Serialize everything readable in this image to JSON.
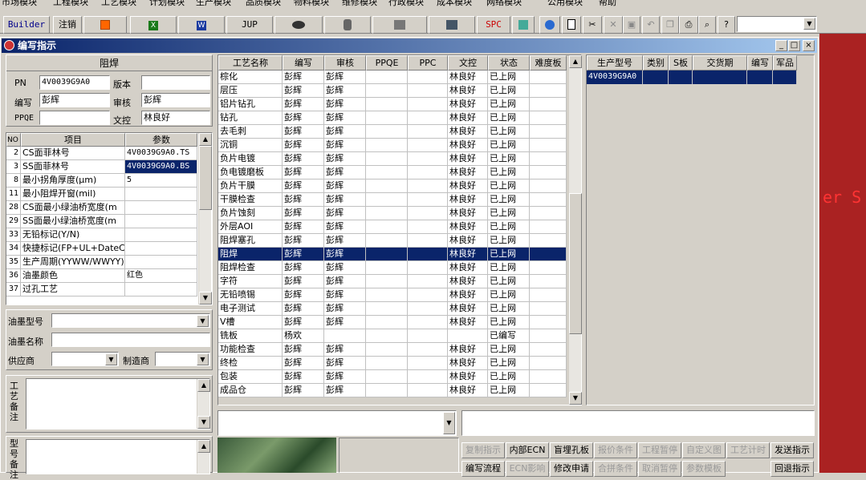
{
  "menubar": {
    "items": [
      "市场模块",
      "工程模块",
      "工艺模块",
      "计划模块",
      "生产模块",
      "品质模块",
      "物料模块",
      "维修模块",
      "行政模块",
      "成本模块",
      "网络模块",
      "公用模块",
      "帮助"
    ]
  },
  "toolbar": {
    "builder_label": "Builder",
    "logout_label": "注销",
    "jup_label": "JUP",
    "spc_label": "SPC"
  },
  "window": {
    "title": "编写指示",
    "minimize": "_",
    "restore": "□",
    "close": "×"
  },
  "form": {
    "section_title": "阻焊",
    "pn_label": "PN",
    "pn_value": "4V0039G9A0",
    "version_label": "版本",
    "version_value": "",
    "writer_label": "编写",
    "writer_value": "彭辉",
    "reviewer_label": "审核",
    "reviewer_value": "彭辉",
    "ppqe_label": "PPQE",
    "ppqe_value": "",
    "doccontrol_label": "文控",
    "doccontrol_value": "林良好"
  },
  "params": {
    "headers": [
      "NO",
      "项目",
      "参数"
    ],
    "rows": [
      {
        "no": "2",
        "item": "CS面菲林号",
        "value": "4V0039G9A0.TS"
      },
      {
        "no": "3",
        "item": "SS面菲林号",
        "value": "4V0039G9A0.BS"
      },
      {
        "no": "8",
        "item": "最小拐角厚度(μm)",
        "value": "5"
      },
      {
        "no": "11",
        "item": "最小阻焊开窗(mil)",
        "value": ""
      },
      {
        "no": "28",
        "item": "CS面最小绿油桥宽度(m",
        "value": ""
      },
      {
        "no": "29",
        "item": "SS面最小绿油桥宽度(m",
        "value": ""
      },
      {
        "no": "33",
        "item": "无铅标记(Y/N)",
        "value": ""
      },
      {
        "no": "34",
        "item": "快捷标记(FP+UL+DateCo",
        "value": ""
      },
      {
        "no": "35",
        "item": "生产周期(YYWW/WWYY)",
        "value": ""
      },
      {
        "no": "36",
        "item": "油墨颜色",
        "value": "红色"
      },
      {
        "no": "37",
        "item": "过孔工艺",
        "value": ""
      }
    ]
  },
  "ink": {
    "type_label": "油墨型号",
    "name_label": "油墨名称",
    "supplier_label": "供应商",
    "maker_label": "制造商",
    "process_note_label": "工艺备注",
    "model_note_label": "型号备注"
  },
  "process": {
    "headers": [
      "工艺名称",
      "编写",
      "审核",
      "PPQE",
      "PPC",
      "文控",
      "状态",
      "难度板"
    ],
    "rows": [
      {
        "name": "棕化",
        "writer": "彭辉",
        "reviewer": "彭辉",
        "ppqe": "",
        "ppc": "",
        "dc": "林良好",
        "status": "已上网"
      },
      {
        "name": "层压",
        "writer": "彭辉",
        "reviewer": "彭辉",
        "ppqe": "",
        "ppc": "",
        "dc": "林良好",
        "status": "已上网"
      },
      {
        "name": "铝片钻孔",
        "writer": "彭辉",
        "reviewer": "彭辉",
        "ppqe": "",
        "ppc": "",
        "dc": "林良好",
        "status": "已上网"
      },
      {
        "name": "钻孔",
        "writer": "彭辉",
        "reviewer": "彭辉",
        "ppqe": "",
        "ppc": "",
        "dc": "林良好",
        "status": "已上网"
      },
      {
        "name": "去毛刺",
        "writer": "彭辉",
        "reviewer": "彭辉",
        "ppqe": "",
        "ppc": "",
        "dc": "林良好",
        "status": "已上网"
      },
      {
        "name": "沉铜",
        "writer": "彭辉",
        "reviewer": "彭辉",
        "ppqe": "",
        "ppc": "",
        "dc": "林良好",
        "status": "已上网"
      },
      {
        "name": "负片电镀",
        "writer": "彭辉",
        "reviewer": "彭辉",
        "ppqe": "",
        "ppc": "",
        "dc": "林良好",
        "status": "已上网"
      },
      {
        "name": "负电镀磨板",
        "writer": "彭辉",
        "reviewer": "彭辉",
        "ppqe": "",
        "ppc": "",
        "dc": "林良好",
        "status": "已上网"
      },
      {
        "name": "负片干膜",
        "writer": "彭辉",
        "reviewer": "彭辉",
        "ppqe": "",
        "ppc": "",
        "dc": "林良好",
        "status": "已上网"
      },
      {
        "name": "干膜检查",
        "writer": "彭辉",
        "reviewer": "彭辉",
        "ppqe": "",
        "ppc": "",
        "dc": "林良好",
        "status": "已上网"
      },
      {
        "name": "负片蚀刻",
        "writer": "彭辉",
        "reviewer": "彭辉",
        "ppqe": "",
        "ppc": "",
        "dc": "林良好",
        "status": "已上网"
      },
      {
        "name": "外层AOI",
        "writer": "彭辉",
        "reviewer": "彭辉",
        "ppqe": "",
        "ppc": "",
        "dc": "林良好",
        "status": "已上网"
      },
      {
        "name": "阻焊塞孔",
        "writer": "彭辉",
        "reviewer": "彭辉",
        "ppqe": "",
        "ppc": "",
        "dc": "林良好",
        "status": "已上网"
      },
      {
        "name": "阻焊",
        "writer": "彭辉",
        "reviewer": "彭辉",
        "ppqe": "",
        "ppc": "",
        "dc": "林良好",
        "status": "已上网"
      },
      {
        "name": "阻焊检查",
        "writer": "彭辉",
        "reviewer": "彭辉",
        "ppqe": "",
        "ppc": "",
        "dc": "林良好",
        "status": "已上网"
      },
      {
        "name": "字符",
        "writer": "彭辉",
        "reviewer": "彭辉",
        "ppqe": "",
        "ppc": "",
        "dc": "林良好",
        "status": "已上网"
      },
      {
        "name": "无铅喷锡",
        "writer": "彭辉",
        "reviewer": "彭辉",
        "ppqe": "",
        "ppc": "",
        "dc": "林良好",
        "status": "已上网"
      },
      {
        "name": "电子测试",
        "writer": "彭辉",
        "reviewer": "彭辉",
        "ppqe": "",
        "ppc": "",
        "dc": "林良好",
        "status": "已上网"
      },
      {
        "name": "V槽",
        "writer": "彭辉",
        "reviewer": "彭辉",
        "ppqe": "",
        "ppc": "",
        "dc": "林良好",
        "status": "已上网"
      },
      {
        "name": "铣板",
        "writer": "杨欢",
        "reviewer": "",
        "ppqe": "",
        "ppc": "",
        "dc": "",
        "status": "已编写"
      },
      {
        "name": "功能检查",
        "writer": "彭辉",
        "reviewer": "彭辉",
        "ppqe": "",
        "ppc": "",
        "dc": "林良好",
        "status": "已上网"
      },
      {
        "name": "终检",
        "writer": "彭辉",
        "reviewer": "彭辉",
        "ppqe": "",
        "ppc": "",
        "dc": "林良好",
        "status": "已上网"
      },
      {
        "name": "包装",
        "writer": "彭辉",
        "reviewer": "彭辉",
        "ppqe": "",
        "ppc": "",
        "dc": "林良好",
        "status": "已上网"
      },
      {
        "name": "成品仓",
        "writer": "彭辉",
        "reviewer": "彭辉",
        "ppqe": "",
        "ppc": "",
        "dc": "林良好",
        "status": "已上网"
      }
    ],
    "selected_index": 13
  },
  "models": {
    "headers": [
      "生产型号",
      "类别",
      "S板",
      "交货期",
      "编写",
      "军品"
    ],
    "rows": [
      {
        "model": "4V0039G9A0",
        "cat": "",
        "s": "",
        "date": "",
        "writer": "",
        "mil": ""
      }
    ]
  },
  "actions": {
    "row1": [
      "复制指示",
      "内部ECN",
      "盲埋孔板",
      "报价条件",
      "工程暂停",
      "自定义图",
      "工艺计时",
      "发送指示"
    ],
    "row2": [
      "编写流程",
      "ECN影响",
      "修改申请",
      "合拼条件",
      "取消暂停",
      "参数模板",
      "",
      "回退指示"
    ]
  },
  "background": {
    "partial_text": "er S"
  },
  "colors": {
    "selection": "#0a246a",
    "title_start": "#0a246a",
    "title_end": "#a6caf0",
    "background_app": "#aa2222"
  }
}
